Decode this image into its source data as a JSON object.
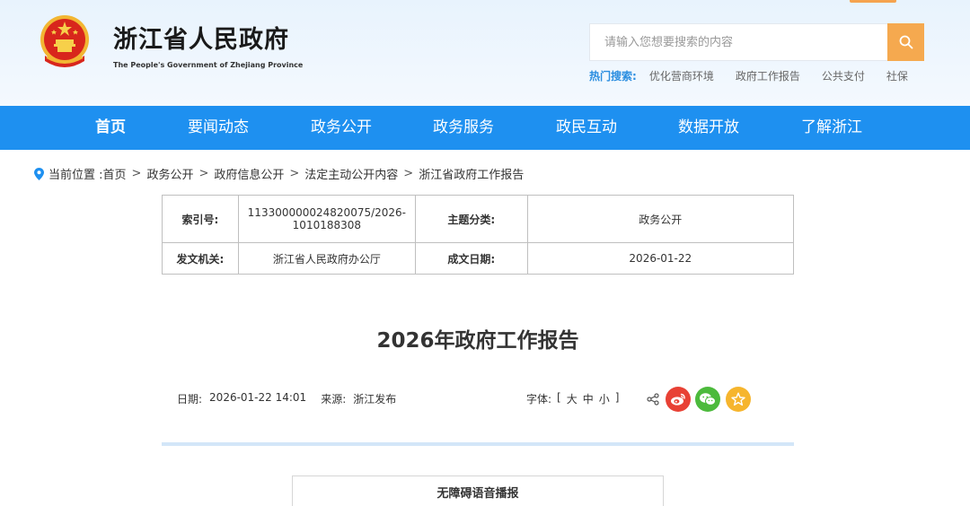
{
  "header": {
    "site_name": "浙江省人民政府",
    "site_name_en": "The People's Government of Zhejiang Province",
    "search_placeholder": "请输入您想要搜索的内容",
    "hot_label": "热门搜索:",
    "hot_links": [
      "优化营商环境",
      "政府工作报告",
      "公共支付",
      "社保"
    ]
  },
  "nav": {
    "items": [
      "首页",
      "要闻动态",
      "政务公开",
      "政务服务",
      "政民互动",
      "数据开放",
      "了解浙江"
    ],
    "active_index": 0
  },
  "breadcrumb": {
    "prefix": "当前位置 :",
    "items": [
      "首页",
      "政务公开",
      "政府信息公开",
      "法定主动公开内容",
      "浙江省政府工作报告"
    ]
  },
  "info": {
    "index_label": "索引号:",
    "index_value": "113300000024820075/2026-1010188308",
    "topic_label": "主题分类:",
    "topic_value": "政务公开",
    "issuer_label": "发文机关:",
    "issuer_value": "浙江省人民政府办公厅",
    "date_label": "成文日期:",
    "date_value": "2026-01-22"
  },
  "article": {
    "title": "2026年政府工作报告",
    "date_label": "日期:",
    "date_value": "2026-01-22 14:01",
    "source_label": "来源:",
    "source_value": "浙江发布",
    "font_label": "字体:",
    "font_open": "[",
    "font_large": "大",
    "font_medium": "中",
    "font_small": "小",
    "font_close": "]",
    "accessibility_label": "无障碍语音播报"
  },
  "colors": {
    "nav_bg": "#1e90f0",
    "search_btn": "#f5a94f",
    "hot_label": "#2a8de0",
    "weibo": "#e84135",
    "wechat": "#4cba3c",
    "favorite": "#f6b52d"
  },
  "icons": [
    "national-emblem-icon",
    "search-icon",
    "location-pin-icon",
    "share-icon",
    "weibo-icon",
    "wechat-icon",
    "star-icon"
  ]
}
